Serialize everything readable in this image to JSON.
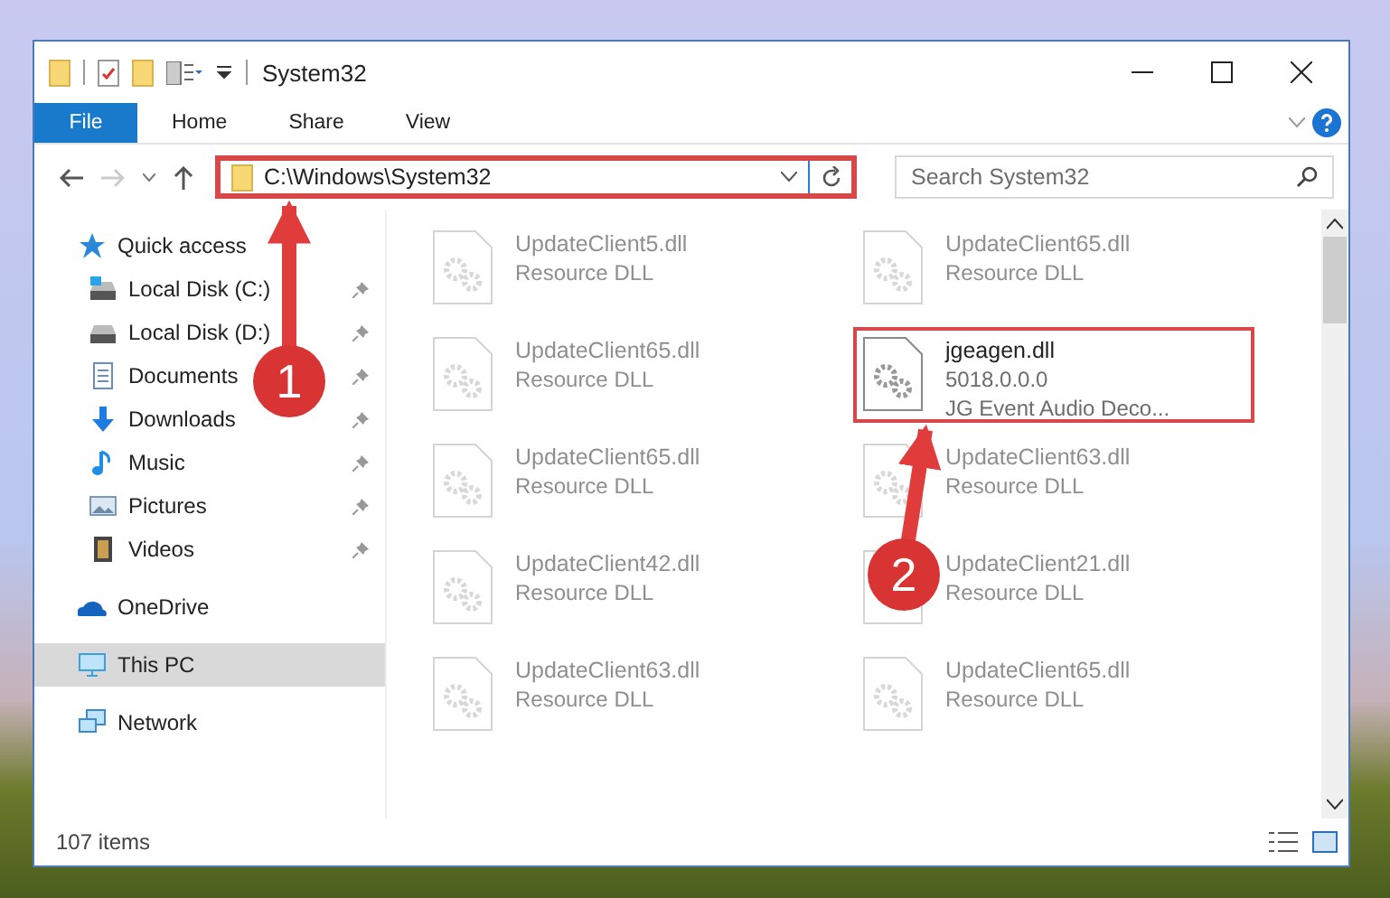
{
  "window": {
    "title": "System32"
  },
  "ribbon_tabs": [
    {
      "label": "File",
      "selected": true
    },
    {
      "label": "Home",
      "selected": false
    },
    {
      "label": "Share",
      "selected": false
    },
    {
      "label": "View",
      "selected": false
    }
  ],
  "address": {
    "value": "C:\\Windows\\System32",
    "highlighted": true
  },
  "search": {
    "placeholder": "Search System32"
  },
  "navigation": [
    {
      "label": "Quick access",
      "kind": "star",
      "selected": false,
      "children": [
        {
          "label": "Local Disk (C:)",
          "kind": "system-drive",
          "pinned": true,
          "selected": false
        },
        {
          "label": "Local Disk (D:)",
          "kind": "drive",
          "pinned": true,
          "selected": false
        },
        {
          "label": "Documents",
          "kind": "documents",
          "pinned": true,
          "selected": false
        },
        {
          "label": "Downloads",
          "kind": "downloads",
          "pinned": true,
          "selected": false
        },
        {
          "label": "Music",
          "kind": "music",
          "pinned": true,
          "selected": false
        },
        {
          "label": "Pictures",
          "kind": "pictures",
          "pinned": true,
          "selected": false
        },
        {
          "label": "Videos",
          "kind": "videos",
          "pinned": true,
          "selected": false
        }
      ]
    },
    {
      "label": "OneDrive",
      "kind": "cloud",
      "selected": false
    },
    {
      "label": "This PC",
      "kind": "computer",
      "selected": true
    },
    {
      "label": "Network",
      "kind": "network",
      "selected": false
    }
  ],
  "files": [
    {
      "lines": [
        "UpdateClient5.dll",
        "Resource DLL"
      ],
      "highlighted": false
    },
    {
      "lines": [
        "UpdateClient65.dll",
        "Resource DLL"
      ],
      "highlighted": false
    },
    {
      "lines": [
        "UpdateClient65.dll",
        "Resource DLL"
      ],
      "highlighted": false
    },
    {
      "lines": [
        "jgeagen.dll",
        "5018.0.0.0",
        "JG Event Audio Deco..."
      ],
      "highlighted": true
    },
    {
      "lines": [
        "UpdateClient65.dll",
        "Resource DLL"
      ],
      "highlighted": false
    },
    {
      "lines": [
        "UpdateClient63.dll",
        "Resource DLL"
      ],
      "highlighted": false
    },
    {
      "lines": [
        "UpdateClient42.dll",
        "Resource DLL"
      ],
      "highlighted": false
    },
    {
      "lines": [
        "UpdateClient21.dll",
        "Resource DLL"
      ],
      "highlighted": false
    },
    {
      "lines": [
        "UpdateClient63.dll",
        "Resource DLL"
      ],
      "highlighted": false
    },
    {
      "lines": [
        "UpdateClient65.dll",
        "Resource DLL"
      ],
      "highlighted": false
    }
  ],
  "status_bar": {
    "item_count": "107 items"
  },
  "annotations": [
    {
      "number": "1"
    },
    {
      "number": "2"
    }
  ]
}
